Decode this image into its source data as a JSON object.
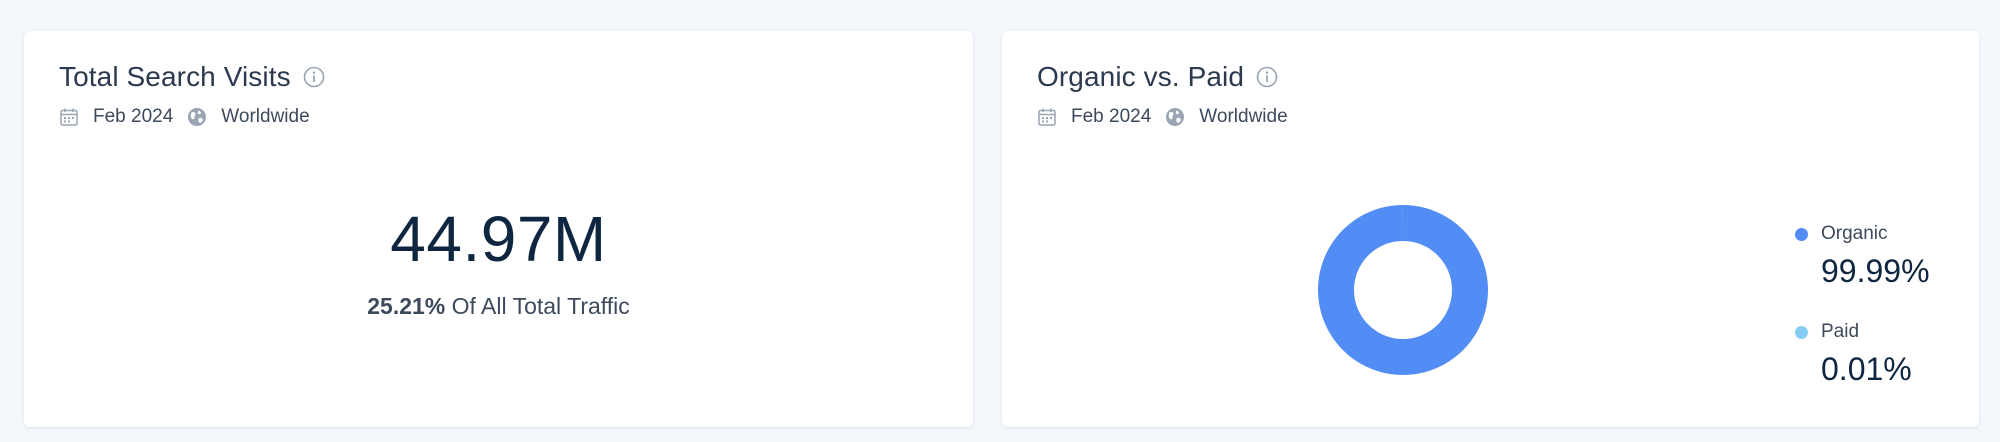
{
  "colors": {
    "organic": "#528cf5",
    "paid": "#86ccf2",
    "icon_gray": "#9aa4b2"
  },
  "total_search_visits": {
    "title": "Total Search Visits",
    "info_icon": "info-circle-icon",
    "date_icon": "calendar-icon",
    "date": "Feb 2024",
    "region_icon": "globe-icon",
    "region": "Worldwide",
    "value": "44.97M",
    "share_pct": "25.21%",
    "share_text": "Of All Total Traffic"
  },
  "organic_vs_paid": {
    "title": "Organic vs. Paid",
    "info_icon": "info-circle-icon",
    "date_icon": "calendar-icon",
    "date": "Feb 2024",
    "region_icon": "globe-icon",
    "region": "Worldwide",
    "legend": [
      {
        "label": "Organic",
        "value": "99.99%"
      },
      {
        "label": "Paid",
        "value": "0.01%"
      }
    ]
  },
  "chart_data": {
    "type": "pie",
    "categories": [
      "Organic",
      "Paid"
    ],
    "values": [
      99.99,
      0.01
    ],
    "colors": [
      "#528cf5",
      "#86ccf2"
    ],
    "title": "Organic vs. Paid",
    "legend_position": "right"
  }
}
